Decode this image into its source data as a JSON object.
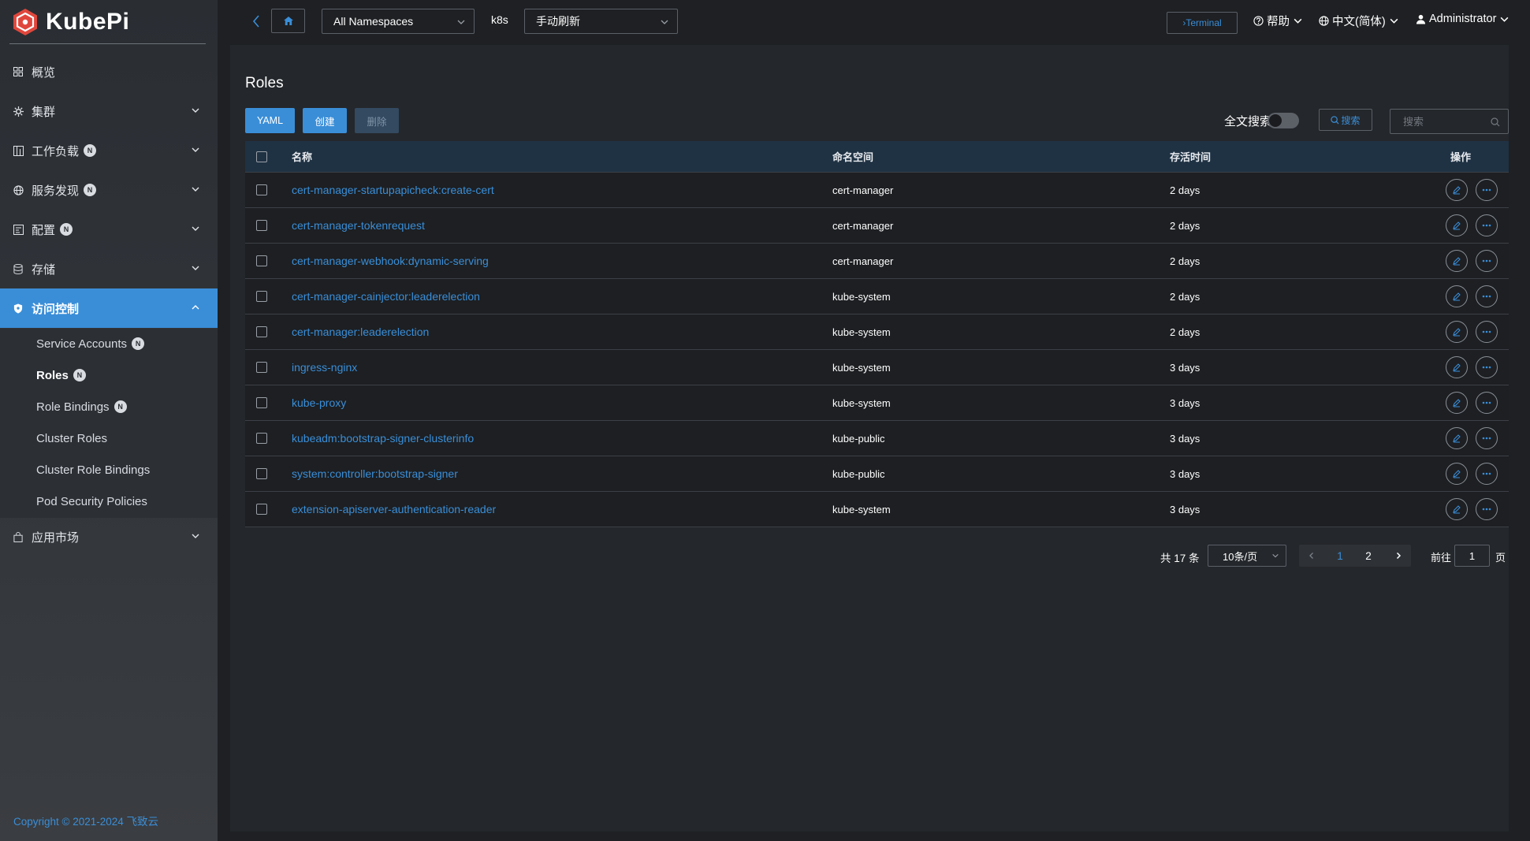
{
  "brand": {
    "name": "KubePi",
    "accent": "#3a8ed8",
    "logo_color": "#e0473c"
  },
  "sidebar": {
    "items": [
      {
        "label": "概览",
        "icon": "dashboard-icon",
        "badge": "",
        "expandable": false
      },
      {
        "label": "集群",
        "icon": "cluster-icon",
        "badge": "",
        "expandable": true
      },
      {
        "label": "工作负载",
        "icon": "workload-icon",
        "badge": "N",
        "expandable": true
      },
      {
        "label": "服务发现",
        "icon": "globe-icon",
        "badge": "N",
        "expandable": true
      },
      {
        "label": "配置",
        "icon": "config-icon",
        "badge": "N",
        "expandable": true
      },
      {
        "label": "存储",
        "icon": "database-icon",
        "badge": "",
        "expandable": true
      },
      {
        "label": "访问控制",
        "icon": "shield-icon",
        "badge": "",
        "expandable": true,
        "active": true
      },
      {
        "label": "应用市场",
        "icon": "bag-icon",
        "badge": "",
        "expandable": true
      }
    ],
    "access_control_children": [
      {
        "label": "Service Accounts",
        "badge": "N"
      },
      {
        "label": "Roles",
        "badge": "N",
        "active": true
      },
      {
        "label": "Role Bindings",
        "badge": "N"
      },
      {
        "label": "Cluster Roles",
        "badge": ""
      },
      {
        "label": "Cluster Role Bindings",
        "badge": ""
      },
      {
        "label": "Pod Security Policies",
        "badge": ""
      }
    ],
    "copyright": "Copyright © 2021-2024 飞致云"
  },
  "topbar": {
    "namespace_select": "All Namespaces",
    "cluster": "k8s",
    "refresh_select": "手动刷新",
    "terminal_label": "Terminal",
    "help_label": "帮助",
    "language_label": "中文(简体)",
    "user_label": "Administrator"
  },
  "page": {
    "title": "Roles",
    "buttons": {
      "yaml": "YAML",
      "create": "创建",
      "delete": "删除"
    },
    "fulltext_label": "全文搜索",
    "search_button": "搜索",
    "search_placeholder": "搜索",
    "table": {
      "headers": {
        "name": "名称",
        "namespace": "命名空间",
        "age": "存活时间",
        "ops": "操作"
      },
      "rows": [
        {
          "name": "cert-manager-startupapicheck:create-cert",
          "namespace": "cert-manager",
          "age": "2 days"
        },
        {
          "name": "cert-manager-tokenrequest",
          "namespace": "cert-manager",
          "age": "2 days"
        },
        {
          "name": "cert-manager-webhook:dynamic-serving",
          "namespace": "cert-manager",
          "age": "2 days"
        },
        {
          "name": "cert-manager-cainjector:leaderelection",
          "namespace": "kube-system",
          "age": "2 days"
        },
        {
          "name": "cert-manager:leaderelection",
          "namespace": "kube-system",
          "age": "2 days"
        },
        {
          "name": "ingress-nginx",
          "namespace": "kube-system",
          "age": "3 days"
        },
        {
          "name": "kube-proxy",
          "namespace": "kube-system",
          "age": "3 days"
        },
        {
          "name": "kubeadm:bootstrap-signer-clusterinfo",
          "namespace": "kube-public",
          "age": "3 days"
        },
        {
          "name": "system:controller:bootstrap-signer",
          "namespace": "kube-public",
          "age": "3 days"
        },
        {
          "name": "extension-apiserver-authentication-reader",
          "namespace": "kube-system",
          "age": "3 days"
        }
      ]
    },
    "pagination": {
      "total": "共 17 条",
      "page_size": "10条/页",
      "pages": [
        "1",
        "2"
      ],
      "current_page": "1",
      "goto_label": "前往",
      "goto_value": "1",
      "goto_suffix": "页"
    }
  }
}
